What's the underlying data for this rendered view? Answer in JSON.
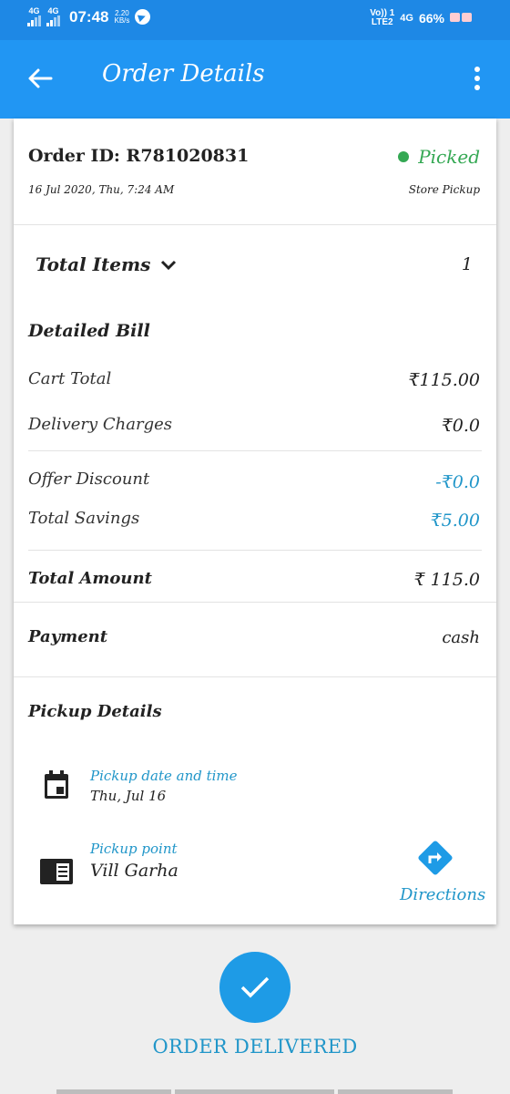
{
  "status_bar": {
    "sim1": "4G",
    "sim2": "4G",
    "time": "07:48",
    "speed_value": "2.20",
    "speed_unit": "KB/s",
    "volte_top": "Vo)) 1",
    "volte_bottom": "LTE2",
    "network_right": "4G",
    "battery": "66%"
  },
  "app_bar": {
    "title": "Order Details"
  },
  "order": {
    "id_text": "Order ID: R781020831",
    "date_text": "16 Jul 2020, Thu, 7:24 AM",
    "status": "Picked",
    "status_color": "#34a853",
    "pickup_type": "Store Pickup"
  },
  "items": {
    "label": "Total Items",
    "count": "1"
  },
  "bill": {
    "heading": "Detailed Bill",
    "cart_total_label": "Cart Total",
    "cart_total_value": "₹115.00",
    "delivery_label": "Delivery Charges",
    "delivery_value": "₹0.0",
    "offer_label": "Offer Discount",
    "offer_value": "-₹0.0",
    "savings_label": "Total Savings",
    "savings_value": "₹5.00",
    "total_label": "Total Amount",
    "total_value": "₹ 115.0"
  },
  "payment": {
    "label": "Payment",
    "value": "cash"
  },
  "pickup": {
    "heading": "Pickup Details",
    "datetime_label": "Pickup date and time",
    "datetime_value": "Thu, Jul 16",
    "point_label": "Pickup point",
    "point_value": "Vill Garha",
    "directions_label": "Directions",
    "icons": [
      "calendar-icon",
      "address-card-icon",
      "directions-icon"
    ]
  },
  "footer": {
    "delivered_label": "ORDER DELIVERED"
  },
  "colors": {
    "primary": "#2196f3",
    "status_bar": "#1e88e5",
    "accent_text": "#2196c9",
    "success": "#34a853"
  }
}
